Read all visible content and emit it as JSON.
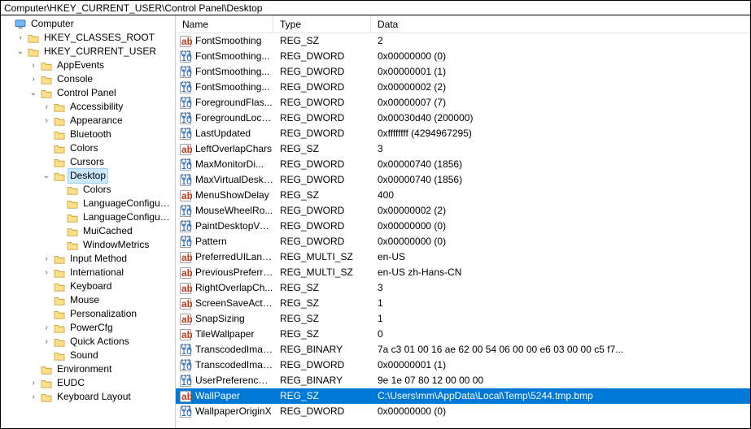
{
  "address": "Computer\\HKEY_CURRENT_USER\\Control Panel\\Desktop",
  "tree": {
    "root": {
      "label": "Computer",
      "icon": "computer",
      "expanded": true,
      "children": [
        {
          "label": "HKEY_CLASSES_ROOT",
          "icon": "folder",
          "expanded": false,
          "hasChildren": true
        },
        {
          "label": "HKEY_CURRENT_USER",
          "icon": "folder",
          "expanded": true,
          "hasChildren": true,
          "children": [
            {
              "label": "AppEvents",
              "icon": "folder",
              "expanded": false,
              "hasChildren": true
            },
            {
              "label": "Console",
              "icon": "folder",
              "expanded": false,
              "hasChildren": true
            },
            {
              "label": "Control Panel",
              "icon": "folder",
              "expanded": true,
              "hasChildren": true,
              "children": [
                {
                  "label": "Accessibility",
                  "icon": "folder",
                  "expanded": false,
                  "hasChildren": true
                },
                {
                  "label": "Appearance",
                  "icon": "folder",
                  "expanded": false,
                  "hasChildren": true
                },
                {
                  "label": "Bluetooth",
                  "icon": "folder",
                  "expanded": false,
                  "hasChildren": false
                },
                {
                  "label": "Colors",
                  "icon": "folder",
                  "expanded": false,
                  "hasChildren": false
                },
                {
                  "label": "Cursors",
                  "icon": "folder",
                  "expanded": false,
                  "hasChildren": false
                },
                {
                  "label": "Desktop",
                  "icon": "folder",
                  "expanded": true,
                  "hasChildren": true,
                  "selected": true,
                  "children": [
                    {
                      "label": "Colors",
                      "icon": "folder",
                      "expanded": false,
                      "hasChildren": false
                    },
                    {
                      "label": "LanguageConfigu…",
                      "icon": "folder",
                      "expanded": false,
                      "hasChildren": false
                    },
                    {
                      "label": "LanguageConfigu…",
                      "icon": "folder",
                      "expanded": false,
                      "hasChildren": false
                    },
                    {
                      "label": "MuiCached",
                      "icon": "folder",
                      "expanded": false,
                      "hasChildren": false
                    },
                    {
                      "label": "WindowMetrics",
                      "icon": "folder",
                      "expanded": false,
                      "hasChildren": false
                    }
                  ]
                },
                {
                  "label": "Input Method",
                  "icon": "folder",
                  "expanded": false,
                  "hasChildren": true
                },
                {
                  "label": "International",
                  "icon": "folder",
                  "expanded": false,
                  "hasChildren": true
                },
                {
                  "label": "Keyboard",
                  "icon": "folder",
                  "expanded": false,
                  "hasChildren": false
                },
                {
                  "label": "Mouse",
                  "icon": "folder",
                  "expanded": false,
                  "hasChildren": false
                },
                {
                  "label": "Personalization",
                  "icon": "folder",
                  "expanded": false,
                  "hasChildren": false
                },
                {
                  "label": "PowerCfg",
                  "icon": "folder",
                  "expanded": false,
                  "hasChildren": true
                },
                {
                  "label": "Quick Actions",
                  "icon": "folder",
                  "expanded": false,
                  "hasChildren": true
                },
                {
                  "label": "Sound",
                  "icon": "folder",
                  "expanded": false,
                  "hasChildren": false
                }
              ]
            },
            {
              "label": "Environment",
              "icon": "folder",
              "expanded": false,
              "hasChildren": false
            },
            {
              "label": "EUDC",
              "icon": "folder",
              "expanded": false,
              "hasChildren": true
            },
            {
              "label": "Keyboard Layout",
              "icon": "folder",
              "expanded": false,
              "hasChildren": true
            }
          ]
        }
      ]
    }
  },
  "columns": {
    "name": "Name",
    "type": "Type",
    "data": "Data"
  },
  "values": [
    {
      "name": "FontSmoothing",
      "type": "REG_SZ",
      "data": "2",
      "iconKind": "string"
    },
    {
      "name": "FontSmoothing...",
      "type": "REG_DWORD",
      "data": "0x00000000 (0)",
      "iconKind": "binary"
    },
    {
      "name": "FontSmoothing...",
      "type": "REG_DWORD",
      "data": "0x00000001 (1)",
      "iconKind": "binary"
    },
    {
      "name": "FontSmoothing...",
      "type": "REG_DWORD",
      "data": "0x00000002 (2)",
      "iconKind": "binary"
    },
    {
      "name": "ForegroundFlas...",
      "type": "REG_DWORD",
      "data": "0x00000007 (7)",
      "iconKind": "binary"
    },
    {
      "name": "ForegroundLock...",
      "type": "REG_DWORD",
      "data": "0x00030d40 (200000)",
      "iconKind": "binary"
    },
    {
      "name": "LastUpdated",
      "type": "REG_DWORD",
      "data": "0xffffffff (4294967295)",
      "iconKind": "binary"
    },
    {
      "name": "LeftOverlapChars",
      "type": "REG_SZ",
      "data": "3",
      "iconKind": "string"
    },
    {
      "name": "MaxMonitorDi...",
      "type": "REG_DWORD",
      "data": "0x00000740 (1856)",
      "iconKind": "binary"
    },
    {
      "name": "MaxVirtualDeskt...",
      "type": "REG_DWORD",
      "data": "0x00000740 (1856)",
      "iconKind": "binary"
    },
    {
      "name": "MenuShowDelay",
      "type": "REG_SZ",
      "data": "400",
      "iconKind": "string"
    },
    {
      "name": "MouseWheelRo...",
      "type": "REG_DWORD",
      "data": "0x00000002 (2)",
      "iconKind": "binary"
    },
    {
      "name": "PaintDesktopVer...",
      "type": "REG_DWORD",
      "data": "0x00000000 (0)",
      "iconKind": "binary"
    },
    {
      "name": "Pattern",
      "type": "REG_DWORD",
      "data": "0x00000000 (0)",
      "iconKind": "binary"
    },
    {
      "name": "PreferredUILang...",
      "type": "REG_MULTI_SZ",
      "data": "en-US",
      "iconKind": "string"
    },
    {
      "name": "PreviousPreferre...",
      "type": "REG_MULTI_SZ",
      "data": "en-US zh-Hans-CN",
      "iconKind": "string"
    },
    {
      "name": "RightOverlapCh...",
      "type": "REG_SZ",
      "data": "3",
      "iconKind": "string"
    },
    {
      "name": "ScreenSaveActive",
      "type": "REG_SZ",
      "data": "1",
      "iconKind": "string"
    },
    {
      "name": "SnapSizing",
      "type": "REG_SZ",
      "data": "1",
      "iconKind": "string"
    },
    {
      "name": "TileWallpaper",
      "type": "REG_SZ",
      "data": "0",
      "iconKind": "string"
    },
    {
      "name": "TranscodedImag...",
      "type": "REG_BINARY",
      "data": "7a c3 01 00 16 ae 62 00 54 06 00 00 e6 03 00 00 c5 f7...",
      "iconKind": "binary"
    },
    {
      "name": "TranscodedImag...",
      "type": "REG_DWORD",
      "data": "0x00000001 (1)",
      "iconKind": "binary"
    },
    {
      "name": "UserPreferences...",
      "type": "REG_BINARY",
      "data": "9e 1e 07 80 12 00 00 00",
      "iconKind": "binary"
    },
    {
      "name": "WallPaper",
      "type": "REG_SZ",
      "data": "C:\\Users\\mm\\AppData\\Local\\Temp\\5244.tmp.bmp",
      "iconKind": "string",
      "selected": true
    },
    {
      "name": "WallpaperOriginX",
      "type": "REG_DWORD",
      "data": "0x00000000 (0)",
      "iconKind": "binary"
    }
  ]
}
